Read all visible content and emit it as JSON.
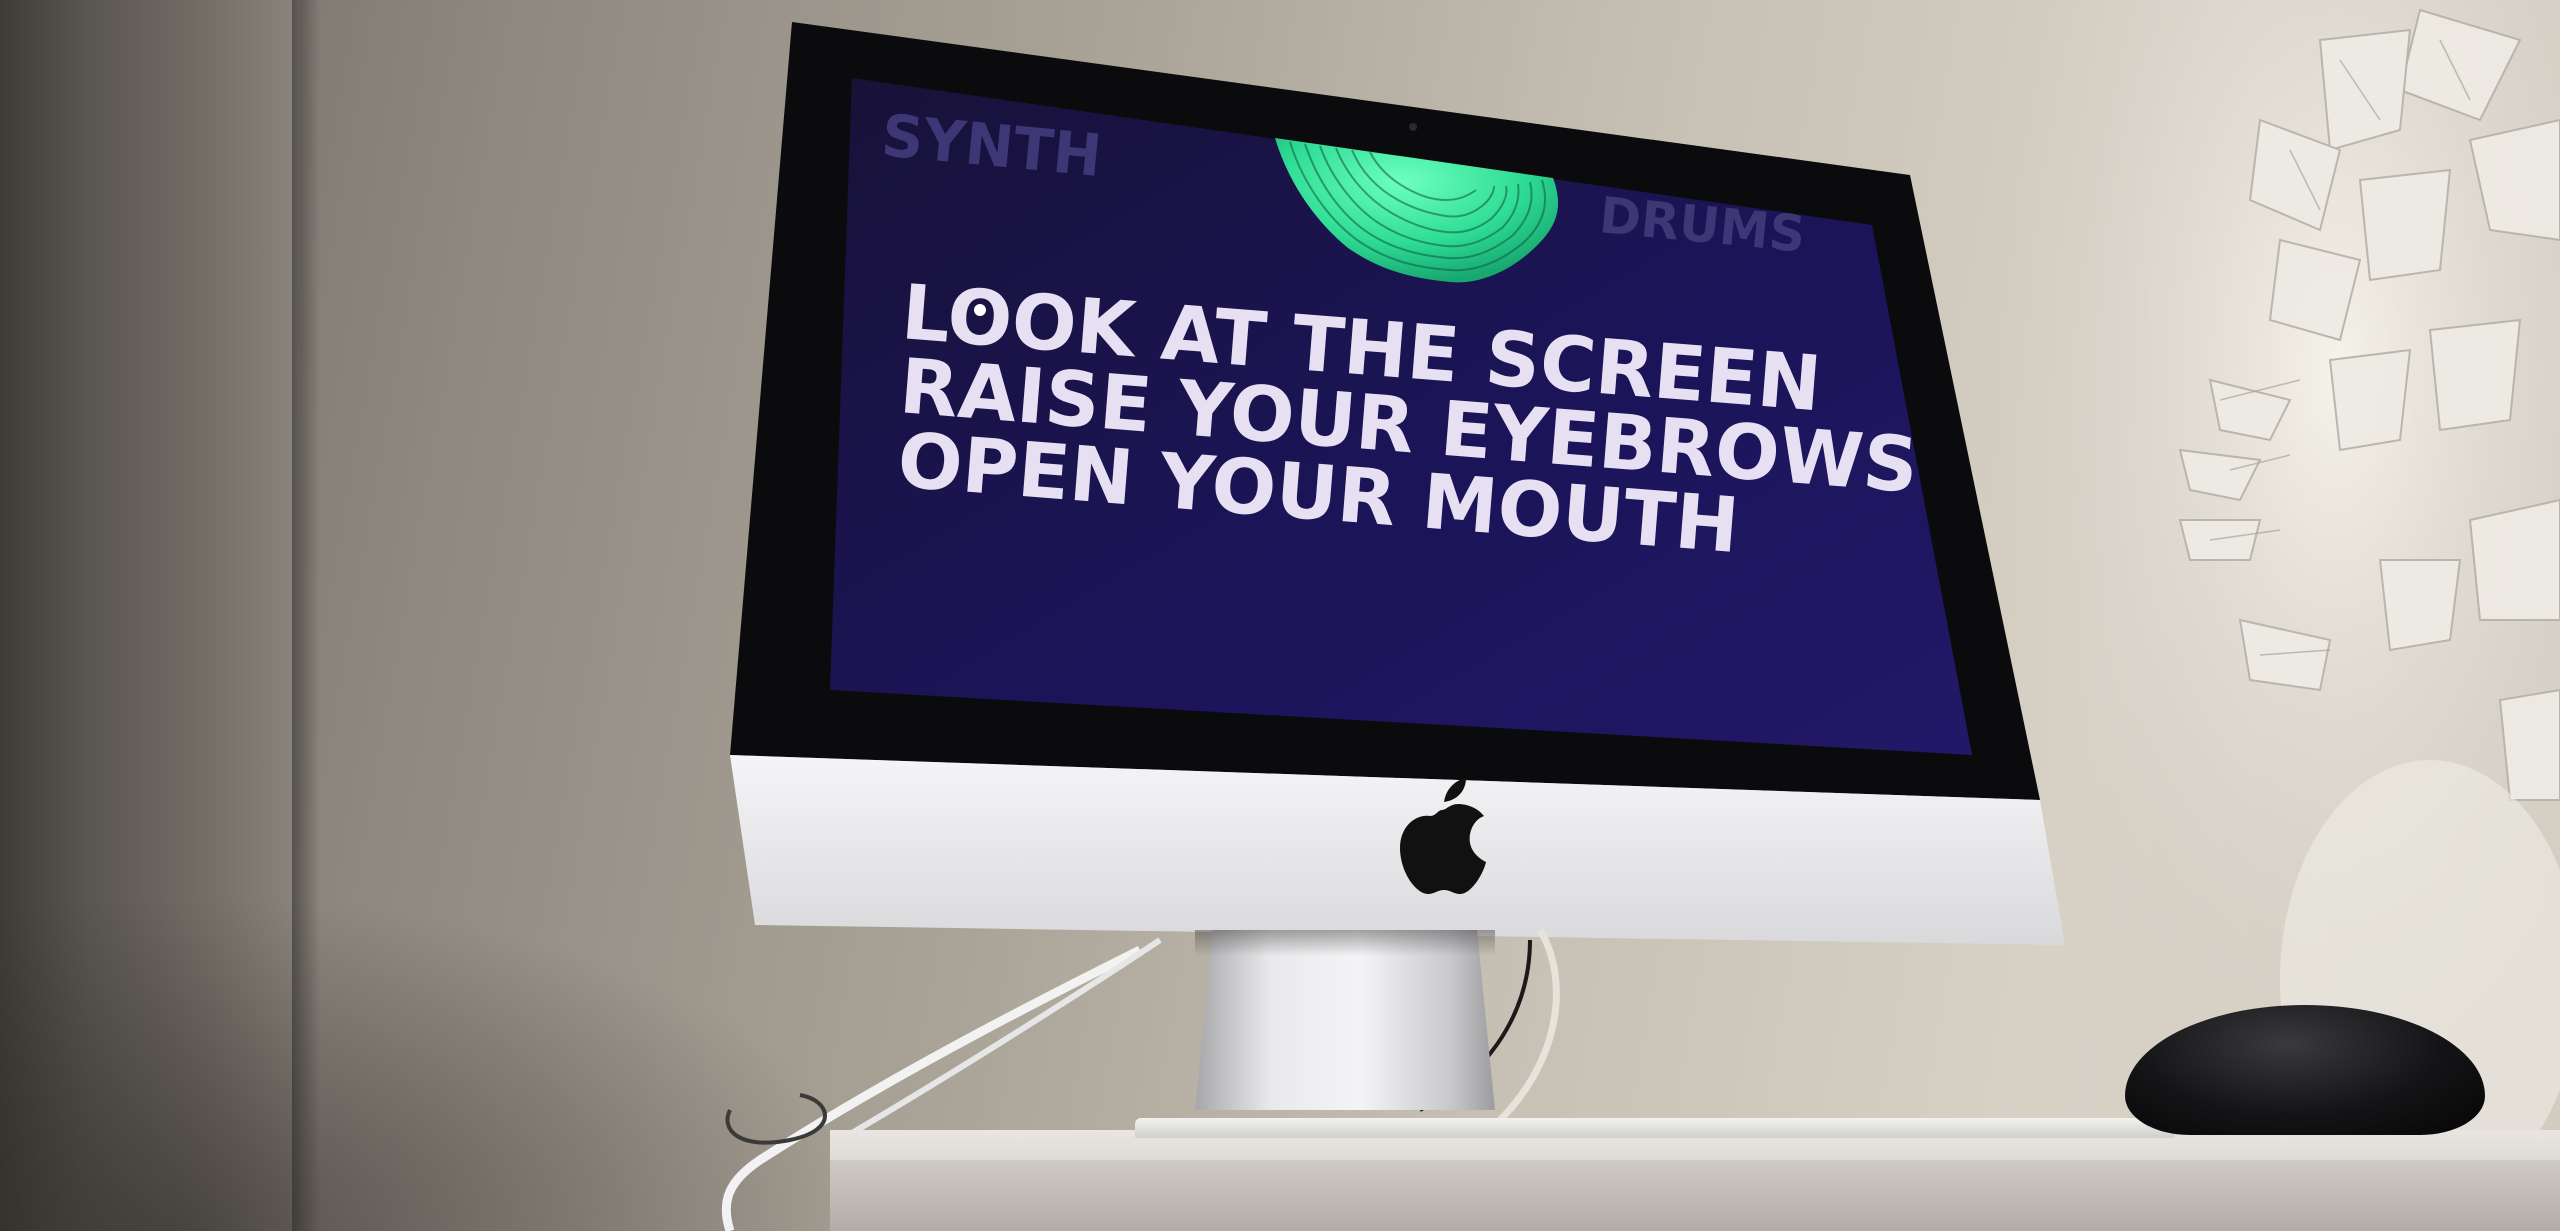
{
  "screen": {
    "tab_left": "SYNTH",
    "tab_right": "DRUMS",
    "instructions": [
      "LOOK AT THE SCREEN",
      "RAISE YOUR EYEBROWS",
      "OPEN YOUR MOUTH"
    ]
  },
  "colors": {
    "screen_bg": "#1b1458",
    "text": "#e6e0f2",
    "tab_text": "#3d3775",
    "visualizer": "#3df0a6",
    "imac_chin": "#f1f1f3",
    "apple_logo": "#111111"
  },
  "icons": {
    "visualizer": "wavy-sound-visualizer",
    "logo": "apple-logo-icon"
  }
}
